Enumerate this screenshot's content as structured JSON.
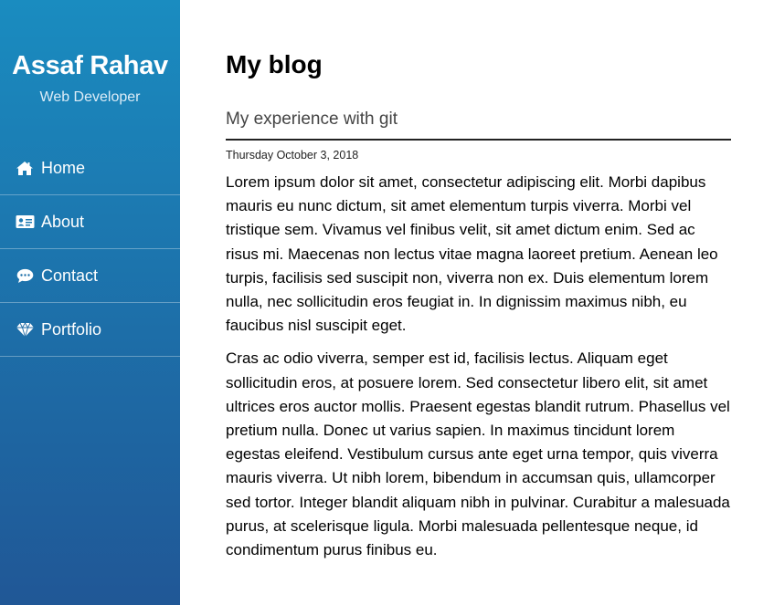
{
  "sidebar": {
    "name": "Assaf Rahav",
    "role": "Web Developer",
    "items": [
      {
        "label": "Home",
        "icon": "home-icon"
      },
      {
        "label": "About",
        "icon": "id-card-icon"
      },
      {
        "label": "Contact",
        "icon": "chat-bubble-icon"
      },
      {
        "label": "Portfolio",
        "icon": "diamond-icon"
      }
    ],
    "colors": {
      "top": "#1a8cc0",
      "bottom": "#205796"
    }
  },
  "main": {
    "page_title": "My blog",
    "post": {
      "title": "My experience with git",
      "date": "Thursday October 3, 2018",
      "paragraphs": [
        "Lorem ipsum dolor sit amet, consectetur adipiscing elit. Morbi dapibus mauris eu nunc dictum, sit amet elementum turpis viverra. Morbi vel tristique sem. Vivamus vel finibus velit, sit amet dictum enim. Sed ac risus mi. Maecenas non lectus vitae magna laoreet pretium. Aenean leo turpis, facilisis sed suscipit non, viverra non ex. Duis elementum lorem nulla, nec sollicitudin eros feugiat in. In dignissim maximus nibh, eu faucibus nisl suscipit eget.",
        "Cras ac odio viverra, semper est id, facilisis lectus. Aliquam eget sollicitudin eros, at posuere lorem. Sed consectetur libero elit, sit amet ultrices eros auctor mollis. Praesent egestas blandit rutrum. Phasellus vel pretium nulla. Donec ut varius sapien. In maximus tincidunt lorem egestas eleifend. Vestibulum cursus ante eget urna tempor, quis viverra mauris viverra. Ut nibh lorem, bibendum in accumsan quis, ullamcorper sed tortor. Integer blandit aliquam nibh in pulvinar. Curabitur a malesuada purus, at scelerisque ligula. Morbi malesuada pellentesque neque, id condimentum purus finibus eu."
      ]
    }
  }
}
